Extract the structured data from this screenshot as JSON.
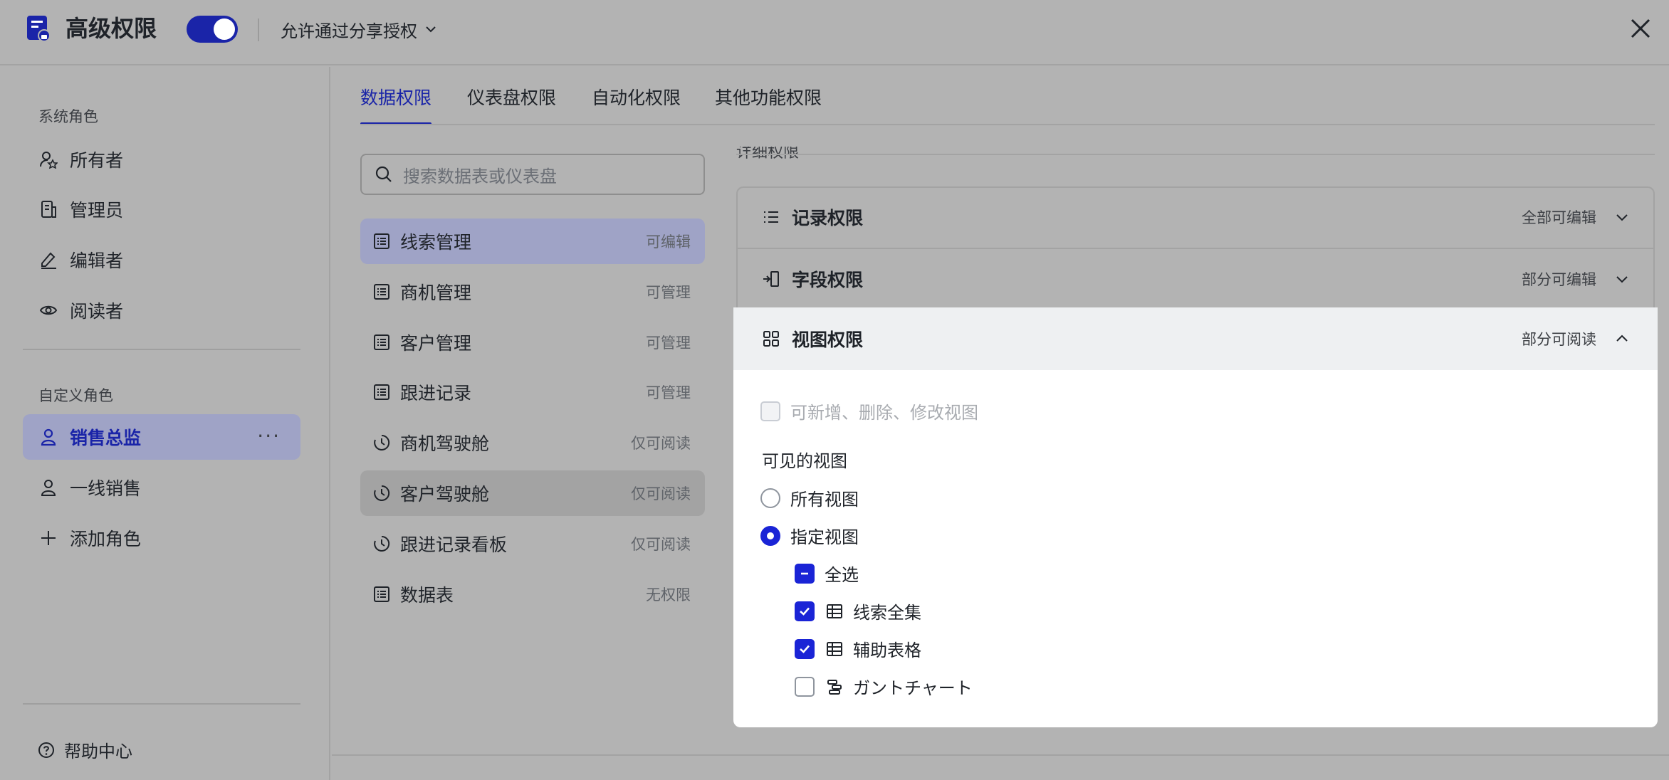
{
  "header": {
    "title": "高级权限",
    "share_option": "允许通过分享授权",
    "toggle_on": true
  },
  "sidebar": {
    "system_roles_title": "系统角色",
    "system_roles": [
      {
        "label": "所有者",
        "icon": "owner-icon"
      },
      {
        "label": "管理员",
        "icon": "admin-icon"
      },
      {
        "label": "编辑者",
        "icon": "editor-icon"
      },
      {
        "label": "阅读者",
        "icon": "reader-icon"
      }
    ],
    "custom_roles_title": "自定义角色",
    "custom_roles": [
      {
        "label": "销售总监",
        "icon": "user-icon",
        "active": true
      },
      {
        "label": "一线销售",
        "icon": "user-icon",
        "active": false
      }
    ],
    "add_role_label": "添加角色",
    "help_label": "帮助中心"
  },
  "tabs": [
    {
      "label": "数据权限",
      "active": true
    },
    {
      "label": "仪表盘权限",
      "active": false
    },
    {
      "label": "自动化权限",
      "active": false
    },
    {
      "label": "其他功能权限",
      "active": false
    }
  ],
  "search": {
    "placeholder": "搜索数据表或仪表盘"
  },
  "tables": [
    {
      "name": "线索管理",
      "permission": "可编辑",
      "icon": "table-icon"
    },
    {
      "name": "商机管理",
      "permission": "可管理",
      "icon": "table-icon"
    },
    {
      "name": "客户管理",
      "permission": "可管理",
      "icon": "table-icon"
    },
    {
      "name": "跟进记录",
      "permission": "可管理",
      "icon": "table-icon"
    },
    {
      "name": "商机驾驶舱",
      "permission": "仅可阅读",
      "icon": "dashboard-icon"
    },
    {
      "name": "客户驾驶舱",
      "permission": "仅可阅读",
      "icon": "dashboard-icon"
    },
    {
      "name": "跟进记录看板",
      "permission": "仅可阅读",
      "icon": "dashboard-icon"
    },
    {
      "name": "数据表",
      "permission": "无权限",
      "icon": "table-icon"
    }
  ],
  "details": {
    "title": "详细权限",
    "sections": [
      {
        "label": "记录权限",
        "status": "全部可编辑",
        "icon": "list-icon"
      },
      {
        "label": "字段权限",
        "status": "部分可编辑",
        "icon": "field-icon"
      },
      {
        "label": "视图权限",
        "status": "部分可阅读",
        "icon": "grid-icon"
      }
    ],
    "view_permission": {
      "modify_views_label": "可新增、删除、修改视图",
      "visible_views_title": "可见的视图",
      "all_views_label": "所有视图",
      "specified_views_label": "指定视图",
      "select_all_label": "全选",
      "views": [
        {
          "name": "线索全集",
          "checked": true,
          "icon": "grid-table-icon"
        },
        {
          "name": "辅助表格",
          "checked": true,
          "icon": "grid-table-icon"
        },
        {
          "name": "ガントチャート",
          "checked": false,
          "icon": "gantt-icon"
        }
      ]
    }
  },
  "colors": {
    "accent": "#1a24d6",
    "overlay": "#b3b3b3"
  }
}
